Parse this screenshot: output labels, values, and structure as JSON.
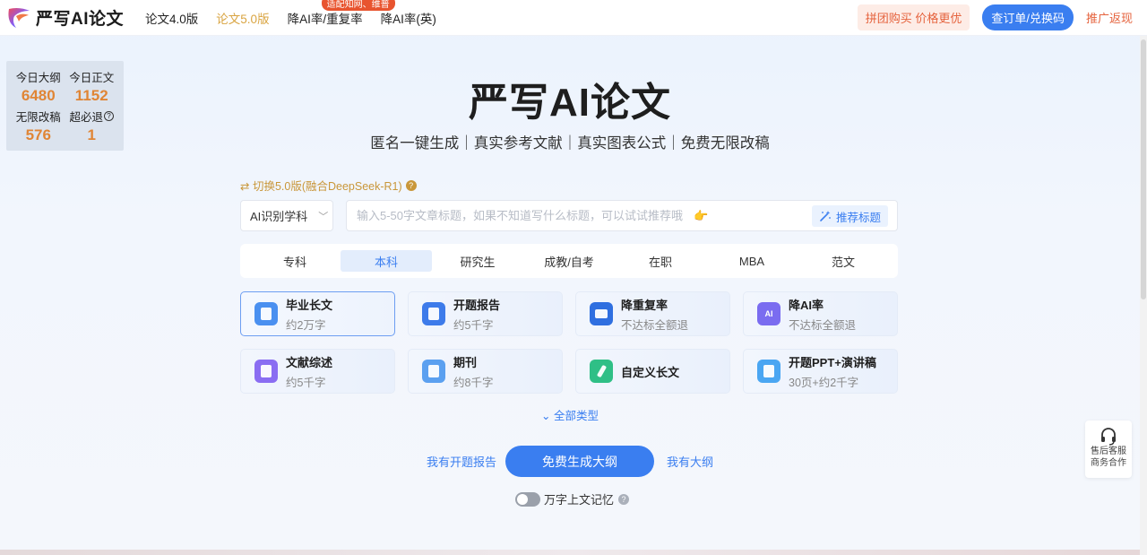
{
  "header": {
    "logo_text": "严写AI论文",
    "nav": [
      {
        "label": "论文4.0版"
      },
      {
        "label": "论文5.0版"
      },
      {
        "label": "降AI率/重复率",
        "badge": "适配知网、维普"
      },
      {
        "label": "降AI率(英)"
      }
    ],
    "group_buy": "拼团购买 价格更优",
    "order_button": "查订单/兑换码",
    "promo_link": "推广返现"
  },
  "stats": {
    "outline_label": "今日大纲",
    "outline_value": "6480",
    "body_label": "今日正文",
    "body_value": "1152",
    "unlimited_label": "无限改稿",
    "unlimited_value": "576",
    "refund_label": "超必退",
    "refund_value": "1"
  },
  "hero": {
    "title": "严写AI论文",
    "subtitle": "匿名一键生成｜真实参考文献｜真实图表公式｜免费无限改稿"
  },
  "switch_link": "⇄ 切换5.0版(融合DeepSeek-R1)",
  "subject_select": "AI识别学科",
  "title_input": {
    "placeholder": "输入5-50字文章标题，如果不知道写什么标题，可以试试推荐哦",
    "hand_emoji": "👉"
  },
  "recommend_button": "推荐标题",
  "levels": [
    "专科",
    "本科",
    "研究生",
    "成教/自考",
    "在职",
    "MBA",
    "范文"
  ],
  "cards": [
    {
      "title": "毕业长文",
      "desc": "约2万字",
      "color": "#4a90f0"
    },
    {
      "title": "开题报告",
      "desc": "约5千字",
      "color": "#3d7bea"
    },
    {
      "title": "降重复率",
      "desc": "不达标全额退",
      "color": "#2f6fe0"
    },
    {
      "title": "降AI率",
      "desc": "不达标全额退",
      "color": "#7a6cf0"
    },
    {
      "title": "文献综述",
      "desc": "约5千字",
      "color": "#8a6df2"
    },
    {
      "title": "期刊",
      "desc": "约8千字",
      "color": "#5ba0f0"
    },
    {
      "title": "自定义长文",
      "desc": "",
      "color": "#2fbf86"
    },
    {
      "title": "开题PPT+演讲稿",
      "desc": "30页+约2千字",
      "color": "#4aa6f2"
    }
  ],
  "all_types": "⌄ 全部类型",
  "generate": {
    "left_link": "我有开题报告",
    "button": "免费生成大纲",
    "right_link": "我有大纲"
  },
  "memory_label": "万字上文记忆",
  "service": {
    "line1": "售后客服",
    "line2": "商务合作"
  }
}
